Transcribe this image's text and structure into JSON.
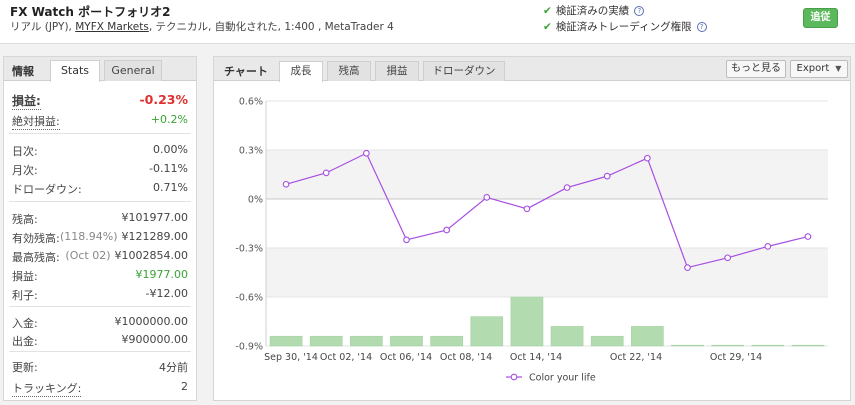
{
  "header": {
    "title": "FX Watch ポートフォリオ2",
    "subtitle_pre": "リアル (JPY), ",
    "subtitle_link": "MYFX Markets",
    "subtitle_post": ", テクニカル, 自動化された, 1:400 , MetaTrader 4",
    "verified_track": "検証済みの実績",
    "verified_trading": "検証済みトレーディング権限",
    "follow_button": "追従",
    "help_glyph": "?",
    "check_glyph": "✔"
  },
  "left_panel": {
    "heading": "情報",
    "tabs": [
      "Stats",
      "General"
    ],
    "active_tab": 0,
    "gain": {
      "label": "損益:",
      "value": "-0.23%"
    },
    "abs_gain": {
      "label": "絶対損益:",
      "value": "+0.2%"
    },
    "daily": {
      "label": "日次:",
      "value": "0.00%"
    },
    "monthly": {
      "label": "月次:",
      "value": "-0.11%"
    },
    "drawdown": {
      "label": "ドローダウン:",
      "value": "0.71%"
    },
    "balance": {
      "label": "残高:",
      "value": "¥101977.00"
    },
    "equity": {
      "label": "有効残高:",
      "pct": "(118.94%)",
      "value": "¥121289.00"
    },
    "highest": {
      "label": "最高残高:",
      "date": "(Oct 02)",
      "value": "¥1002854.00"
    },
    "profit": {
      "label": "損益:",
      "value": "¥1977.00"
    },
    "interest": {
      "label": "利子:",
      "value": "-¥12.00"
    },
    "deposits": {
      "label": "入金:",
      "value": "¥1000000.00"
    },
    "withdrawals": {
      "label": "出金:",
      "value": "¥900000.00"
    },
    "updated": {
      "label": "更新:",
      "value": "4分前"
    },
    "tracking": {
      "label": "トラッキング:",
      "value": "2"
    }
  },
  "chart_panel": {
    "heading": "チャート",
    "tabs": [
      "成長",
      "残高",
      "損益",
      "ドローダウン"
    ],
    "active_tab": 0,
    "more_button": "もっと見る",
    "export_button": "Export",
    "dropdown_glyph": "▼"
  },
  "colors": {
    "line": "#a64fe0",
    "bar": "#b2dcb0",
    "bar_border": "#9fcf9c",
    "loss": "#e0302e",
    "gain": "#3aa335",
    "follow_button": "#5cb85c",
    "band": "#f3f3f3"
  },
  "chart_data": {
    "type": "line",
    "title": "",
    "x_tick_labels": [
      "Sep 30, '14",
      "Oct 02, '14",
      "Oct 06, '14",
      "Oct 08, '14",
      "Oct 14, '14",
      "Oct 22, '14",
      "Oct 29, '14"
    ],
    "ylim": [
      -0.9,
      0.6
    ],
    "y_ticks": [
      0.6,
      0.3,
      0,
      -0.3,
      -0.6,
      -0.9
    ],
    "y_tick_labels": [
      "0.6%",
      "0.3%",
      "0%",
      "-0.3%",
      "-0.6%",
      "-0.9%"
    ],
    "grid": true,
    "legend": {
      "position": "bottom",
      "label": "Color your life"
    },
    "series": [
      {
        "type": "line",
        "values": [
          0.09,
          0.16,
          0.28,
          -0.25,
          -0.19,
          0.01,
          -0.06,
          0.07,
          0.14,
          0.25,
          -0.42,
          -0.36,
          -0.29,
          -0.23
        ]
      },
      {
        "type": "bar",
        "values": [
          -0.84,
          -0.84,
          -0.84,
          -0.84,
          -0.84,
          -0.72,
          -0.6,
          -0.78,
          -0.84,
          -0.78,
          -0.895,
          -0.895,
          -0.895,
          -0.895
        ]
      }
    ]
  }
}
